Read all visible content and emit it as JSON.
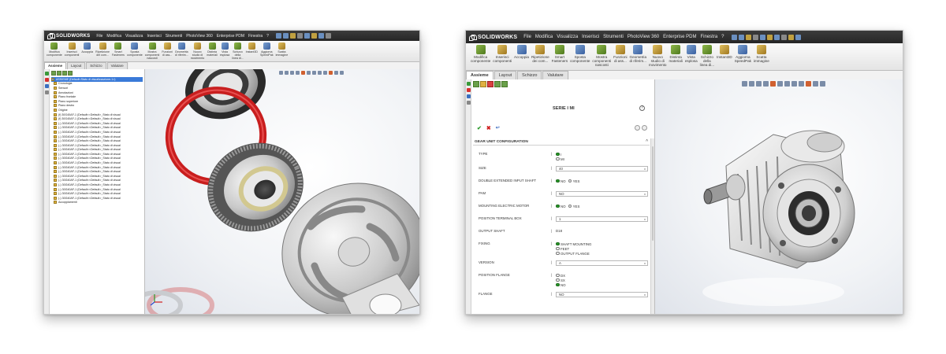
{
  "app": {
    "logo_text": "SOLIDWORKS",
    "menu": [
      "File",
      "Modifica",
      "Visualizza",
      "Inserisci",
      "Strumenti",
      "PhotoView 360",
      "Enterprise PDM",
      "Finestra",
      "?"
    ]
  },
  "left_window": {
    "ribbon_buttons": [
      "Modifica\ncomponente",
      "Inserisci\ncomponenti",
      "Accoppia",
      "Ripetizione\ndei com...",
      "Smart\nFasteners",
      "Sposta\ncomponente",
      "Mostra\ncomponenti\nnascosti",
      "Funzioni\ndi ass...",
      "Geometria\ndi riferim...",
      "Nuovo\nstudio di\nmovimento",
      "Distinta\nmateriali",
      "Vista\nesplosa",
      "Schizzo\ndella\nlinea di...",
      "Instant3D",
      "Aggiorna\nSpeedPak",
      "Scatta\nimmagine"
    ],
    "tabs": [
      "Assieme",
      "Layout",
      "Schizzo",
      "Valutare"
    ],
    "active_tab": "Assieme",
    "tree": [
      {
        "label": "ASSIEME (Default<Stato di visualizzazione-1>)",
        "level": 0,
        "selected": true
      },
      {
        "label": "Cronologia",
        "level": 1
      },
      {
        "label": "Sensori",
        "level": 1
      },
      {
        "label": "Annotazioni",
        "level": 1
      },
      {
        "label": "Piano frontale",
        "level": 1
      },
      {
        "label": "Piano superiore",
        "level": 1
      },
      {
        "label": "Piano destro",
        "level": 1
      },
      {
        "label": "Origine",
        "level": 1
      },
      {
        "label": "(f) 30G40AF-1 (Default<<Default>_Stato di visual",
        "level": 1
      },
      {
        "label": "(f) 30G40AF-1 (Default<<Default>_Stato di visual",
        "level": 1
      },
      {
        "label": "(-) 30G40AF-1 (Default<<Default>_Stato di visual",
        "level": 1
      },
      {
        "label": "(-) 30G40AF-1 (Default<<Default>_Stato di visual",
        "level": 1
      },
      {
        "label": "(-) 30G40AF-1 (Default<<Default>_Stato di visual",
        "level": 1
      },
      {
        "label": "(-) 30G40AF-1 (Default<<Default>_Stato di visual",
        "level": 1
      },
      {
        "label": "(-) 30G40AF-1 (Default<<Default>_Stato di visual",
        "level": 1
      },
      {
        "label": "(-) 30G40AF-1 (Default<<Default>_Stato di visual",
        "level": 1
      },
      {
        "label": "(-) 30G40AF-1 (Default<<Default>_Stato di visual",
        "level": 1
      },
      {
        "label": "(-) 30G40AF-1 (Default<<Default>_Stato di visual",
        "level": 1
      },
      {
        "label": "(-) 30G40AF-1 (Default<<Default>_Stato di visual",
        "level": 1
      },
      {
        "label": "(-) 30G40AF-1 (Default<<Default>_Stato di visual",
        "level": 1
      },
      {
        "label": "(-) 30G40AF-1 (Default<<Default>_Stato di visual",
        "level": 1
      },
      {
        "label": "(-) 30G40AF-1 (Default<<Default>_Stato di visual",
        "level": 1
      },
      {
        "label": "(-) 30G40AF-1 (Default<<Default>_Stato di visual",
        "level": 1
      },
      {
        "label": "(-) 30G40AF-1 (Default<<Default>_Stato di visual",
        "level": 1
      },
      {
        "label": "(-) 30G40AF-1 (Default<<Default>_Stato di visual",
        "level": 1
      },
      {
        "label": "(-) 30G40AF-1 (Default<<Default>_Stato di visual",
        "level": 1
      },
      {
        "label": "(-) 30G40AF-1 (Default<<Default>_Stato di visual",
        "level": 1
      },
      {
        "label": "(-) 30G40AF-1 (Default<<Default>_Stato di visual",
        "level": 1
      },
      {
        "label": "Accoppiamenti",
        "level": 1
      }
    ]
  },
  "right_window": {
    "ribbon_buttons": [
      "Modifica\ncomponente",
      "Inserisci\ncomponenti",
      "Accoppia",
      "Ripetizione\ndei com...",
      "Smart\nFasteners",
      "Sposta\ncomponente",
      "Mostra\ncomponenti\nnascosti",
      "Funzioni\ndi ass...",
      "Geometria\ndi riferim...",
      "Nuovo\nstudio di\nmovimento",
      "Distinta\nmateriali",
      "Vista\nesplosa",
      "Schizzo\ndella\nlinea di...",
      "Instant3D",
      "Aggiorna\nSpeedPak",
      "Scatta\nimmagine"
    ],
    "tabs": [
      "Assieme",
      "Layout",
      "Schizzo",
      "Valutare"
    ],
    "active_tab": "Assieme",
    "property_manager": {
      "title": "SERIE I MI",
      "section": "GEAR UNIT CONFIGURATION",
      "rows": [
        {
          "label": "TYPE",
          "type": "radio",
          "options": [
            "I",
            "MI"
          ],
          "selected": 0
        },
        {
          "label": "SIZE",
          "type": "select",
          "value": "40"
        },
        {
          "label": "DOUBLE EXTENDED INPUT SHAFT",
          "type": "radio-inline",
          "options": [
            "NO",
            "YES"
          ],
          "selected": 0
        },
        {
          "label": "PAM",
          "type": "select",
          "value": "NO"
        },
        {
          "label": "MOUNTING ELECTRIC MOTOR",
          "type": "radio-inline",
          "options": [
            "NO",
            "YES"
          ],
          "selected": 0
        },
        {
          "label": "POSITION TERMINAL BOX",
          "type": "select",
          "value": "1"
        },
        {
          "label": "OUTPUT SHAFT",
          "type": "text",
          "value": "D18"
        },
        {
          "label": "FIXING",
          "type": "radio",
          "options": [
            "SHAFT MOUNTING",
            "FEET",
            "OUTPUT FLANGE"
          ],
          "selected": 0
        },
        {
          "label": "VERSION",
          "type": "select",
          "value": "A"
        },
        {
          "label": "POSITION FLANGE",
          "type": "radio",
          "options": [
            "DX",
            "SX",
            "NO"
          ],
          "selected": 2
        },
        {
          "label": "FLANGE",
          "type": "select",
          "value": "NO"
        }
      ]
    }
  }
}
